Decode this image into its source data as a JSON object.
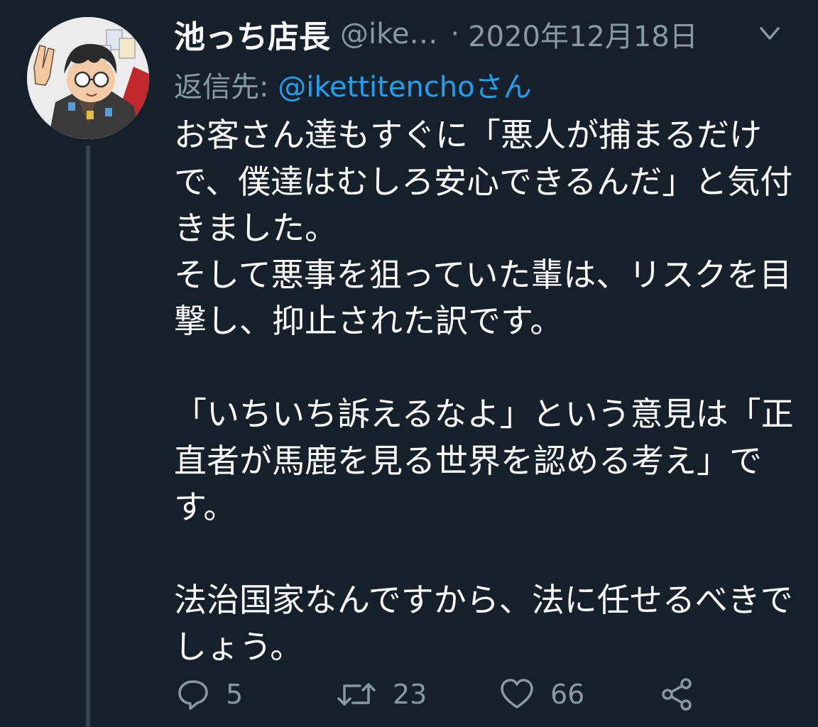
{
  "tweet": {
    "display_name": "池っち店長",
    "handle": "@ike…",
    "separator": "·",
    "date": "2020年12月18日",
    "reply_prefix": "返信先: ",
    "reply_mention": "@ikettitenchoさん",
    "body": "お客さん達もすぐに「悪人が捕まるだけで、僕達はむしろ安心できるんだ」と気付きました。\nそして悪事を狙っていた輩は、リスクを目撃し、抑止された訳です。\n\n「いちいち訴えるなよ」という意見は「正直者が馬鹿を見る世界を認める考え」です。\n\n法治国家なんですから、法に任せるべきでしょう。"
  },
  "actions": {
    "reply_count": "5",
    "retweet_count": "23",
    "like_count": "66"
  },
  "colors": {
    "background": "#15202b",
    "text_primary": "#ffffff",
    "text_secondary": "#8899a6",
    "accent": "#1da1f2",
    "thread_line": "#38444d"
  },
  "icons": {
    "caret": "chevron-down-icon",
    "reply": "comment-icon",
    "retweet": "retweet-icon",
    "like": "heart-icon",
    "share": "share-icon"
  }
}
